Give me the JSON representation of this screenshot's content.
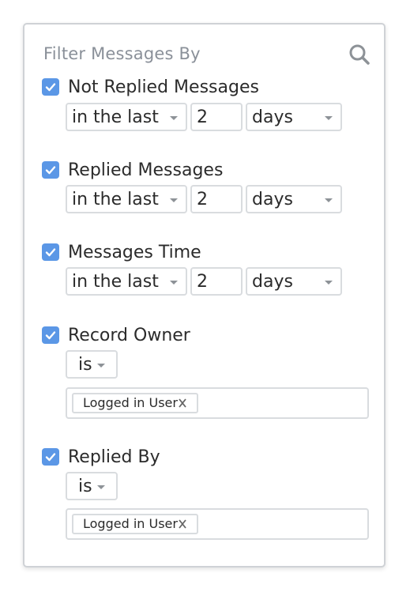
{
  "panel": {
    "title": "Filter Messages By",
    "search_icon": "search-icon"
  },
  "filters": [
    {
      "label": "Not Replied Messages",
      "checked": true,
      "operator": "in the last",
      "value": "2",
      "unit": "days"
    },
    {
      "label": "Replied Messages",
      "checked": true,
      "operator": "in the last",
      "value": "2",
      "unit": "days"
    },
    {
      "label": "Messages Time",
      "checked": true,
      "operator": "in the last",
      "value": "2",
      "unit": "days"
    },
    {
      "label": "Record Owner",
      "checked": true,
      "operator": "is",
      "tags": [
        "Logged in User"
      ]
    },
    {
      "label": "Replied By",
      "checked": true,
      "operator": "is",
      "tags": [
        "Logged in User"
      ]
    }
  ],
  "colors": {
    "checkbox": "#5b97e6",
    "border": "#d9dcdf",
    "title": "#8a9099"
  }
}
